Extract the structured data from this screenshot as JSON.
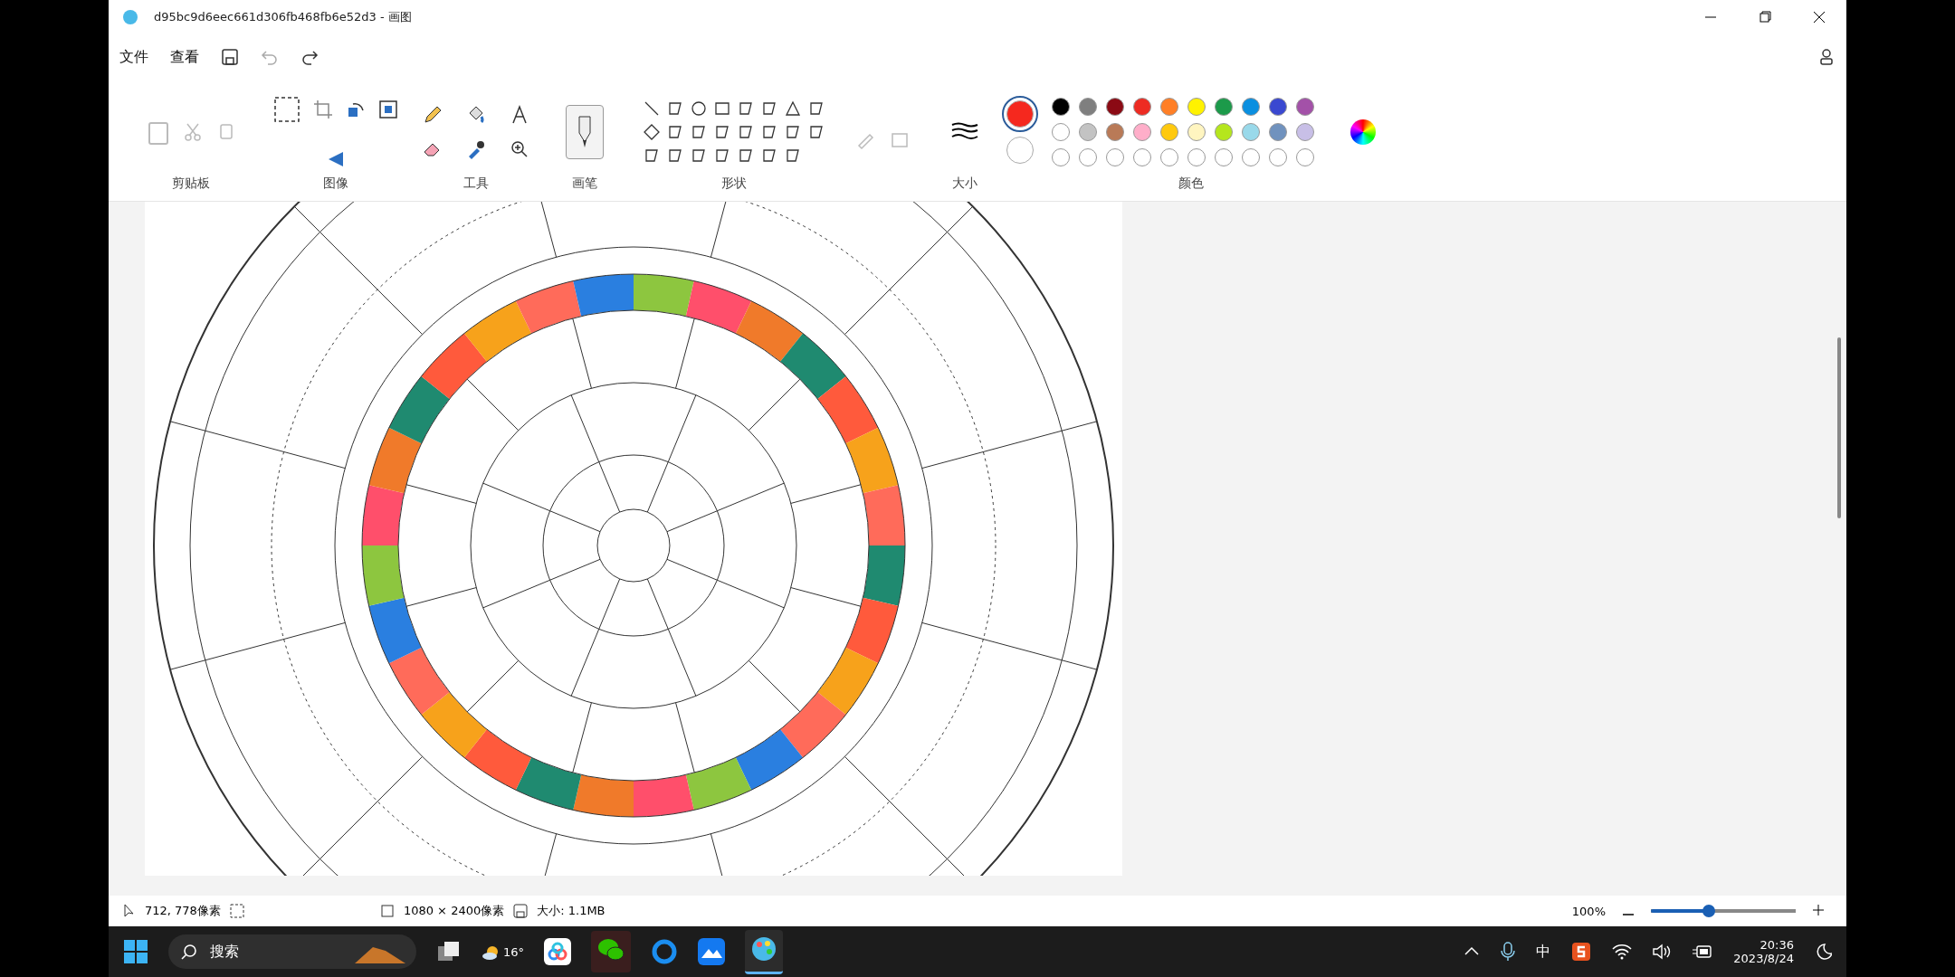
{
  "window": {
    "title": "d95bc9d6eec661d306fb468fb6e52d3 - 画图"
  },
  "menu": [
    "文件",
    "查看"
  ],
  "ribbon_groups": [
    "剪贴板",
    "图像",
    "工具",
    "画笔",
    "形状",
    "大小",
    "颜色"
  ],
  "current_colors": [
    {
      "color": "#f5281e",
      "selected": true
    },
    {
      "color": "#ffffff",
      "selected": false
    }
  ],
  "palette": [
    {
      "color": "#000000"
    },
    {
      "color": "#7f7f7f"
    },
    {
      "color": "#8b0a14"
    },
    {
      "color": "#ed2b22"
    },
    {
      "color": "#ff7f27"
    },
    {
      "color": "#fff200"
    },
    {
      "color": "#1c9a4a"
    },
    {
      "color": "#0a8fe0"
    },
    {
      "color": "#3a48d0"
    },
    {
      "color": "#a351a8"
    },
    {
      "color": "#ffffff"
    },
    {
      "color": "#c3c3c3"
    },
    {
      "color": "#b97a57"
    },
    {
      "color": "#ffaec9"
    },
    {
      "color": "#ffc90e"
    },
    {
      "color": "#fff5c0"
    },
    {
      "color": "#b5e61d"
    },
    {
      "color": "#99d9ea"
    },
    {
      "color": "#7092be"
    },
    {
      "color": "#c8bfe7"
    }
  ],
  "status_bar": {
    "cursor": "712, 778像素",
    "size": "1080 × 2400像素",
    "file_size": "大小: 1.1MB",
    "zoom": "100%",
    "zoom_level": {
      "level": 0.4
    }
  },
  "taskbar": {
    "search": "搜索",
    "weather": "16°",
    "ime": "中",
    "time": "20:36",
    "date": "2023/8/24"
  }
}
